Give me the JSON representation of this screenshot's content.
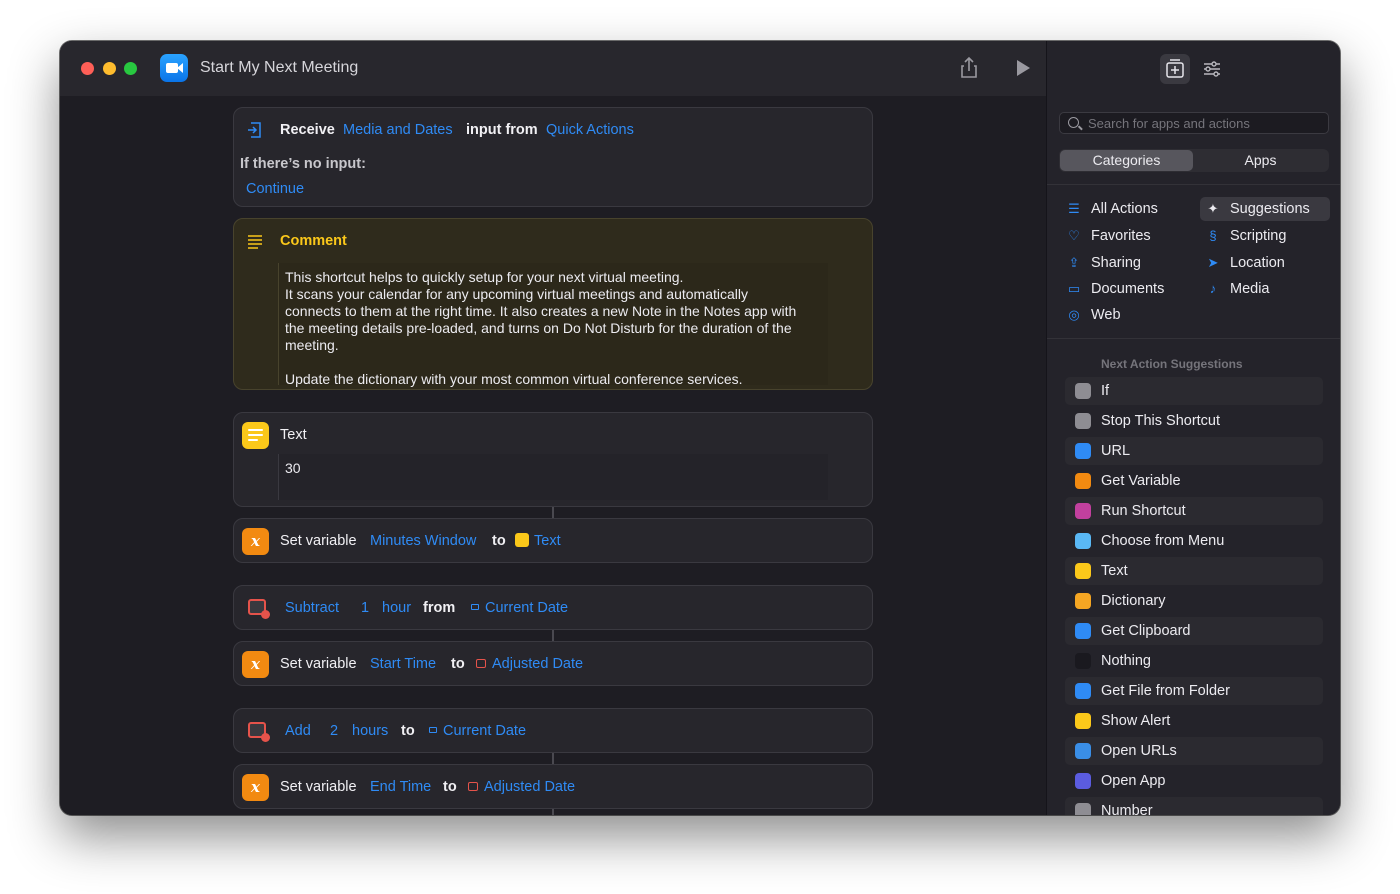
{
  "window": {
    "title": "Start My Next Meeting"
  },
  "workflow": {
    "receive": {
      "verb": "Receive",
      "type_token": "Media and Dates",
      "mid_text": "input from",
      "source_token": "Quick Actions",
      "no_input_label": "If there’s no input:",
      "no_input_value": "Continue"
    },
    "comment": {
      "title": "Comment",
      "body": "This shortcut helps to quickly setup for your next virtual meeting.\nIt scans your calendar for any upcoming virtual meetings and automatically\nconnects to them at the right time. It also creates a new Note in the Notes app with\nthe meeting details pre-loaded, and turns on Do Not Disturb for the duration of the\nmeeting.\n\nUpdate the dictionary with your most common virtual conference services."
    },
    "text_action": {
      "title": "Text",
      "value": "30"
    },
    "set_var_1": {
      "verb": "Set variable",
      "name": "Minutes Window",
      "to": "to",
      "value": "Text"
    },
    "subtract": {
      "op": "Subtract",
      "amount": "1",
      "unit": "hour",
      "from": "from",
      "date": "Current Date"
    },
    "set_var_2": {
      "verb": "Set variable",
      "name": "Start Time",
      "to": "to",
      "value": "Adjusted Date"
    },
    "add": {
      "op": "Add",
      "amount": "2",
      "unit": "hours",
      "to": "to",
      "date": "Current Date"
    },
    "set_var_3": {
      "verb": "Set variable",
      "name": "End Time",
      "to": "to",
      "value": "Adjusted Date"
    }
  },
  "sidebar": {
    "search_placeholder": "Search for apps and actions",
    "segments": [
      "Categories",
      "Apps"
    ],
    "categories_left": [
      "All Actions",
      "Favorites",
      "Sharing",
      "Documents",
      "Web"
    ],
    "categories_right": [
      "Suggestions",
      "Scripting",
      "Location",
      "Media"
    ],
    "next_title": "Next Action Suggestions",
    "suggestions": [
      {
        "label": "If",
        "color": "#8e8d93"
      },
      {
        "label": "Stop This Shortcut",
        "color": "#8e8d93"
      },
      {
        "label": "URL",
        "color": "#2f8bf5"
      },
      {
        "label": "Get Variable",
        "color": "#f28a11"
      },
      {
        "label": "Run Shortcut",
        "color": "#c2409e"
      },
      {
        "label": "Choose from Menu",
        "color": "#5ab8f5"
      },
      {
        "label": "Text",
        "color": "#fbc81a"
      },
      {
        "label": "Dictionary",
        "color": "#f5a623"
      },
      {
        "label": "Get Clipboard",
        "color": "#2f8bf5"
      },
      {
        "label": "Nothing",
        "color": "#1a191f"
      },
      {
        "label": "Get File from Folder",
        "color": "#2f8bf5"
      },
      {
        "label": "Show Alert",
        "color": "#fbc81a"
      },
      {
        "label": "Open URLs",
        "color": "#3a8ee6"
      },
      {
        "label": "Open App",
        "color": "#5b5ce0"
      },
      {
        "label": "Number",
        "color": "#8e8d93"
      }
    ]
  }
}
